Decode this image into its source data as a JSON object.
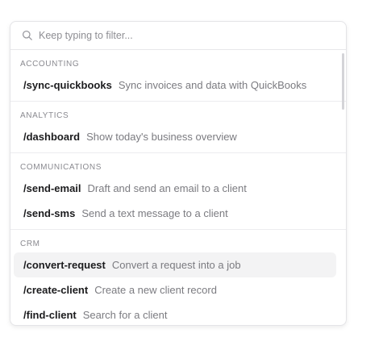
{
  "search": {
    "placeholder": "Keep typing to filter..."
  },
  "groups": [
    {
      "label": "ACCOUNTING",
      "items": [
        {
          "command": "/sync-quickbooks",
          "description": "Sync invoices and data with QuickBooks"
        }
      ]
    },
    {
      "label": "ANALYTICS",
      "items": [
        {
          "command": "/dashboard",
          "description": "Show today's business overview"
        }
      ]
    },
    {
      "label": "COMMUNICATIONS",
      "items": [
        {
          "command": "/send-email",
          "description": "Draft and send an email to a client"
        },
        {
          "command": "/send-sms",
          "description": "Send a text message to a client"
        }
      ]
    },
    {
      "label": "CRM",
      "items": [
        {
          "command": "/convert-request",
          "description": "Convert a request into a job"
        },
        {
          "command": "/create-client",
          "description": "Create a new client record"
        },
        {
          "command": "/find-client",
          "description": "Search for a client"
        }
      ]
    }
  ],
  "highlighted_item": "/convert-request"
}
